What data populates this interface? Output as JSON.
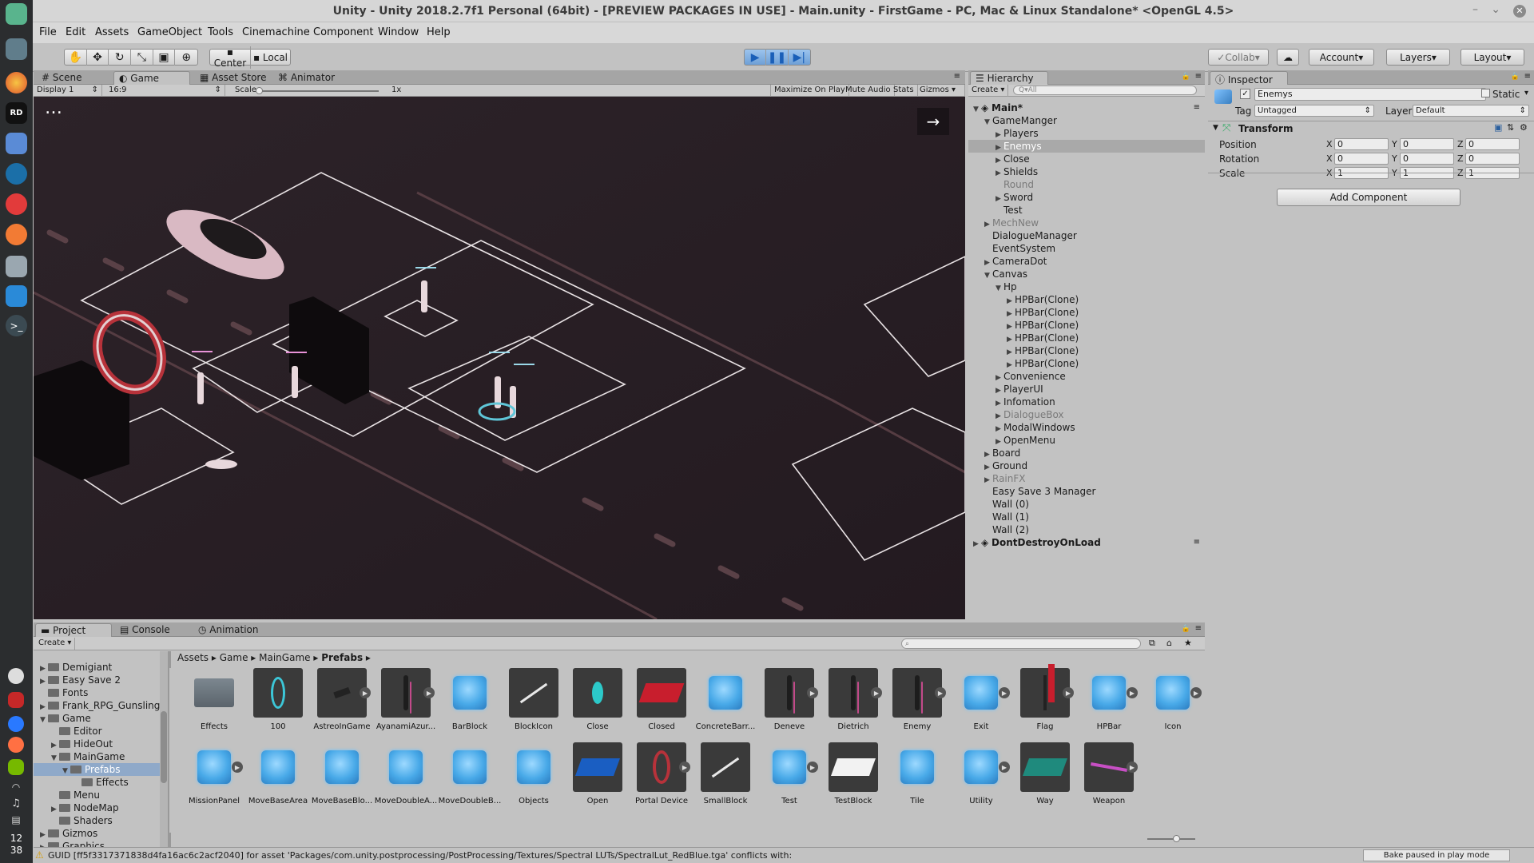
{
  "window": {
    "title": "Unity - Unity 2018.2.7f1 Personal (64bit) - [PREVIEW PACKAGES IN USE] - Main.unity - FirstGame - PC, Mac & Linux Standalone* <OpenGL 4.5>"
  },
  "menu": [
    "File",
    "Edit",
    "Assets",
    "GameObject",
    "Tools",
    "Cinemachine",
    "Component",
    "Window",
    "Help"
  ],
  "dock": {
    "clock_hour": "12",
    "clock_minute": "38"
  },
  "toolbar": {
    "pivot": "Center",
    "space": "Local",
    "collab": "Collab",
    "account": "Account",
    "layers": "Layers",
    "layout": "Layout"
  },
  "scene_tabs": {
    "scene": "Scene",
    "game": "Game",
    "asset_store": "Asset Store",
    "animator": "Animator"
  },
  "game_bar": {
    "display": "Display 1",
    "aspect": "16:9",
    "scale_label": "Scale",
    "scale_value": "1x",
    "maximize": "Maximize On Play",
    "mute": "Mute Audio",
    "stats": "Stats",
    "gizmos": "Gizmos"
  },
  "hierarchy": {
    "tab": "Hierarchy",
    "create": "Create",
    "search_placeholder": "Q▾All",
    "rows": [
      {
        "label": "Main*",
        "indent": 0,
        "arrow": "open",
        "scene": true
      },
      {
        "label": "GameManger",
        "indent": 1,
        "arrow": "open"
      },
      {
        "label": "Players",
        "indent": 2,
        "arrow": "closed"
      },
      {
        "label": "Enemys",
        "indent": 2,
        "arrow": "closed",
        "selected": true
      },
      {
        "label": "Close",
        "indent": 2,
        "arrow": "closed"
      },
      {
        "label": "Shields",
        "indent": 2,
        "arrow": "closed"
      },
      {
        "label": "Round",
        "indent": 2,
        "arrow": "",
        "faded": true
      },
      {
        "label": "Sword",
        "indent": 2,
        "arrow": "closed"
      },
      {
        "label": "Test",
        "indent": 2,
        "arrow": ""
      },
      {
        "label": "MechNew",
        "indent": 1,
        "arrow": "closed",
        "faded": true
      },
      {
        "label": "DialogueManager",
        "indent": 1,
        "arrow": ""
      },
      {
        "label": "EventSystem",
        "indent": 1,
        "arrow": ""
      },
      {
        "label": "CameraDot",
        "indent": 1,
        "arrow": "closed"
      },
      {
        "label": "Canvas",
        "indent": 1,
        "arrow": "open"
      },
      {
        "label": "Hp",
        "indent": 2,
        "arrow": "open"
      },
      {
        "label": "HPBar(Clone)",
        "indent": 3,
        "arrow": "closed"
      },
      {
        "label": "HPBar(Clone)",
        "indent": 3,
        "arrow": "closed"
      },
      {
        "label": "HPBar(Clone)",
        "indent": 3,
        "arrow": "closed"
      },
      {
        "label": "HPBar(Clone)",
        "indent": 3,
        "arrow": "closed"
      },
      {
        "label": "HPBar(Clone)",
        "indent": 3,
        "arrow": "closed"
      },
      {
        "label": "HPBar(Clone)",
        "indent": 3,
        "arrow": "closed"
      },
      {
        "label": "Convenience",
        "indent": 2,
        "arrow": "closed"
      },
      {
        "label": "PlayerUI",
        "indent": 2,
        "arrow": "closed"
      },
      {
        "label": "Infomation",
        "indent": 2,
        "arrow": "closed"
      },
      {
        "label": "DialogueBox",
        "indent": 2,
        "arrow": "closed",
        "faded": true
      },
      {
        "label": "ModalWindows",
        "indent": 2,
        "arrow": "closed"
      },
      {
        "label": "OpenMenu",
        "indent": 2,
        "arrow": "closed"
      },
      {
        "label": "Board",
        "indent": 1,
        "arrow": "closed"
      },
      {
        "label": "Ground",
        "indent": 1,
        "arrow": "closed"
      },
      {
        "label": "RainFX",
        "indent": 1,
        "arrow": "closed",
        "faded": true
      },
      {
        "label": "Easy Save 3 Manager",
        "indent": 1,
        "arrow": ""
      },
      {
        "label": "Wall (0)",
        "indent": 1,
        "arrow": ""
      },
      {
        "label": "Wall (1)",
        "indent": 1,
        "arrow": ""
      },
      {
        "label": "Wall (2)",
        "indent": 1,
        "arrow": ""
      },
      {
        "label": "DontDestroyOnLoad",
        "indent": 0,
        "arrow": "closed",
        "scene": true
      }
    ]
  },
  "inspector": {
    "tab": "Inspector",
    "object_name": "Enemys",
    "static_label": "Static",
    "tag_label": "Tag",
    "tag_value": "Untagged",
    "layer_label": "Layer",
    "layer_value": "Default",
    "component": "Transform",
    "position_label": "Position",
    "rotation_label": "Rotation",
    "scale_label": "Scale",
    "position": {
      "x": "0",
      "y": "0",
      "z": "0"
    },
    "rotation": {
      "x": "0",
      "y": "0",
      "z": "0"
    },
    "scale": {
      "x": "1",
      "y": "1",
      "z": "1"
    },
    "axis_x": "X",
    "axis_y": "Y",
    "axis_z": "Z",
    "add_component": "Add Component"
  },
  "bottom_tabs": {
    "project": "Project",
    "console": "Console",
    "animation": "Animation"
  },
  "project": {
    "create": "Create",
    "breadcrumb": [
      "Assets",
      "Game",
      "MainGame",
      "Prefabs"
    ],
    "tree": [
      {
        "label": "Demigiant",
        "indent": 0,
        "arrow": "closed"
      },
      {
        "label": "Easy Save 2",
        "indent": 0,
        "arrow": "closed"
      },
      {
        "label": "Fonts",
        "indent": 0,
        "arrow": ""
      },
      {
        "label": "Frank_RPG_Gunslinger",
        "indent": 0,
        "arrow": "closed"
      },
      {
        "label": "Game",
        "indent": 0,
        "arrow": "open"
      },
      {
        "label": "Editor",
        "indent": 1,
        "arrow": ""
      },
      {
        "label": "HideOut",
        "indent": 1,
        "arrow": "closed"
      },
      {
        "label": "MainGame",
        "indent": 1,
        "arrow": "open"
      },
      {
        "label": "Prefabs",
        "indent": 2,
        "arrow": "open",
        "selected": true
      },
      {
        "label": "Effects",
        "indent": 3,
        "arrow": ""
      },
      {
        "label": "Menu",
        "indent": 1,
        "arrow": ""
      },
      {
        "label": "NodeMap",
        "indent": 1,
        "arrow": "closed"
      },
      {
        "label": "Shaders",
        "indent": 1,
        "arrow": ""
      },
      {
        "label": "Gizmos",
        "indent": 0,
        "arrow": "closed"
      },
      {
        "label": "Graphics",
        "indent": 0,
        "arrow": "closed"
      }
    ],
    "assets": [
      {
        "label": "Effects",
        "kind": "folder"
      },
      {
        "label": "100",
        "kind": "ring"
      },
      {
        "label": "AstreoInGame",
        "kind": "dark",
        "arrow": true
      },
      {
        "label": "AyanamiAzur...",
        "kind": "char",
        "arrow": true
      },
      {
        "label": "BarBlock",
        "kind": "cube"
      },
      {
        "label": "BlockIcon",
        "kind": "line"
      },
      {
        "label": "Close",
        "kind": "oval"
      },
      {
        "label": "Closed",
        "kind": "red"
      },
      {
        "label": "ConcreteBarr...",
        "kind": "cube"
      },
      {
        "label": "Deneve",
        "kind": "char",
        "arrow": true
      },
      {
        "label": "Dietrich",
        "kind": "char",
        "arrow": true
      },
      {
        "label": "Enemy",
        "kind": "char",
        "arrow": true
      },
      {
        "label": "Exit",
        "kind": "cube",
        "arrow": true
      },
      {
        "label": "Flag",
        "kind": "flag",
        "arrow": true
      },
      {
        "label": "HPBar",
        "kind": "cube",
        "arrow": true
      },
      {
        "label": "Icon",
        "kind": "cube",
        "arrow": true
      },
      {
        "label": "MissionPanel",
        "kind": "cube",
        "arrow": true
      },
      {
        "label": "MoveBaseArea",
        "kind": "cube"
      },
      {
        "label": "MoveBaseBlo...",
        "kind": "cube"
      },
      {
        "label": "MoveDoubleA...",
        "kind": "cube"
      },
      {
        "label": "MoveDoubleB...",
        "kind": "cube"
      },
      {
        "label": "Objects",
        "kind": "cube"
      },
      {
        "label": "Open",
        "kind": "blue"
      },
      {
        "label": "Portal Device",
        "kind": "portal",
        "arrow": true
      },
      {
        "label": "SmallBlock",
        "kind": "line"
      },
      {
        "label": "Test",
        "kind": "cube",
        "arrow": true
      },
      {
        "label": "TestBlock",
        "kind": "white"
      },
      {
        "label": "Tile",
        "kind": "cube"
      },
      {
        "label": "Utility",
        "kind": "cube",
        "arrow": true
      },
      {
        "label": "Way",
        "kind": "teal"
      },
      {
        "label": "Weapon",
        "kind": "weapon",
        "arrow": true
      }
    ]
  },
  "status": {
    "message": "GUID [ff5f3317371838d4fa16ac6c2acf2040] for asset 'Packages/com.unity.postprocessing/PostProcessing/Textures/Spectral LUTs/SpectralLut_RedBlue.tga' conflicts with:",
    "bake": "Bake paused in play mode"
  }
}
